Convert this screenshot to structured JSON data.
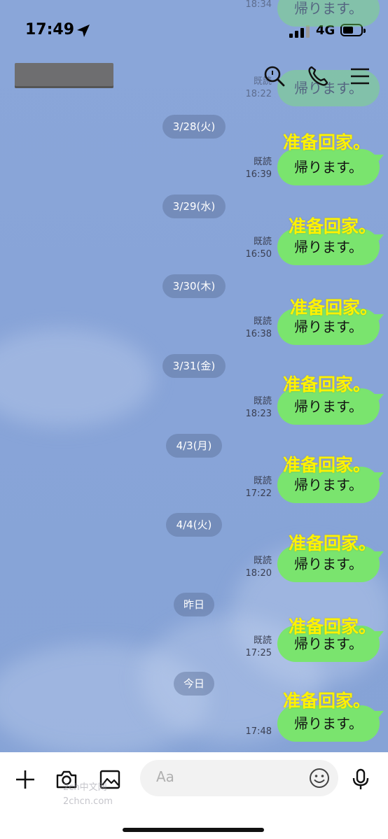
{
  "status_bar": {
    "time": "17:49",
    "network": "4G"
  },
  "ghost_top": {
    "meta_read": "既読",
    "meta_time1": "18:34",
    "meta_time2": "18:22",
    "bubble_text": "帰ります。"
  },
  "messages": [
    {
      "date": "3/28(火)",
      "read": "既読",
      "time": "16:39",
      "text": "帰ります。",
      "overlay": "准备回家。"
    },
    {
      "date": "3/29(水)",
      "read": "既読",
      "time": "16:50",
      "text": "帰ります。",
      "overlay": "准备回家。"
    },
    {
      "date": "3/30(木)",
      "read": "既読",
      "time": "16:38",
      "text": "帰ります。",
      "overlay": "准备回家。"
    },
    {
      "date": "3/31(金)",
      "read": "既読",
      "time": "18:23",
      "text": "帰ります。",
      "overlay": "准备回家。"
    },
    {
      "date": "4/3(月)",
      "read": "既読",
      "time": "17:22",
      "text": "帰ります。",
      "overlay": "准备回家。"
    },
    {
      "date": "4/4(火)",
      "read": "既読",
      "time": "18:20",
      "text": "帰ります。",
      "overlay": "准备回家。"
    },
    {
      "date": "昨日",
      "read": "既読",
      "time": "17:25",
      "text": "帰ります。",
      "overlay": "准备回家。"
    },
    {
      "date": "今日",
      "read": "",
      "time": "17:48",
      "text": "帰ります。",
      "overlay": "准备回家。"
    }
  ],
  "input": {
    "placeholder": "Aa"
  },
  "watermark": {
    "line1": "2ch中文网",
    "line2": "2chcn.com"
  },
  "icons": {
    "header": [
      "search-icon",
      "phone-icon",
      "menu-icon"
    ],
    "input_bar": [
      "plus-icon",
      "camera-icon",
      "image-icon",
      "emoji-icon",
      "microphone-icon"
    ]
  },
  "colors": {
    "bubble": "#7ae46e",
    "overlay_text": "#fff200",
    "background": "#8aa6d9"
  }
}
